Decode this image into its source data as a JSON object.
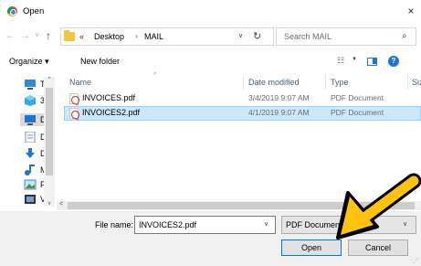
{
  "window": {
    "title": "Open",
    "close_glyph": "×"
  },
  "address": {
    "back_glyph": "←",
    "forward_glyph": "→",
    "recent_glyph": "∨",
    "up_glyph": "↑",
    "more_glyph": "«",
    "crumbs": [
      "Desktop",
      "MAIL"
    ],
    "sep_glyph": "›",
    "dropdown_glyph": "∨",
    "refresh_glyph": "↻"
  },
  "search": {
    "placeholder": "Search MAIL",
    "icon": "search-icon",
    "glyph": "⌕"
  },
  "toolbar": {
    "organize_label": "Organize ▾",
    "new_folder_label": "New folder",
    "view_glyph": "☷",
    "view_dropdown_glyph": "▼",
    "help_glyph": "?"
  },
  "nav_pane": {
    "items": [
      {
        "icon": "this-pc-icon",
        "label": "Th"
      },
      {
        "icon": "3d-objects-icon",
        "label": "3"
      },
      {
        "icon": "desktop-icon",
        "label": "D"
      },
      {
        "icon": "documents-icon",
        "label": "D"
      },
      {
        "icon": "downloads-icon",
        "label": "D"
      },
      {
        "icon": "music-icon",
        "label": "M"
      },
      {
        "icon": "pictures-icon",
        "label": "P"
      },
      {
        "icon": "videos-icon",
        "label": "V"
      }
    ],
    "scroll_up_glyph": "^",
    "scroll_down_glyph": "v"
  },
  "file_list": {
    "sort_glyph": "^",
    "columns": [
      "Name",
      "Date modified",
      "Type",
      "Siz"
    ],
    "rows": [
      {
        "name": "INVOICES.pdf",
        "date": "3/4/2019 9:07 AM",
        "type": "PDF Document",
        "selected": false
      },
      {
        "name": "INVOICES2.pdf",
        "date": "4/1/2019 9:07 AM",
        "type": "PDF Document",
        "selected": true
      }
    ],
    "hscroll_left_glyph": "<"
  },
  "bottom": {
    "filename_label": "File name:",
    "filename_value": "INVOICES2.pdf",
    "dropdown_glyph": "∨",
    "filetype_value": "PDF Document",
    "open_label": "Open",
    "cancel_label": "Cancel"
  },
  "colors": {
    "accent": "#0078d7",
    "selection": "#cce8ff",
    "arrow": "#ffc20e"
  }
}
